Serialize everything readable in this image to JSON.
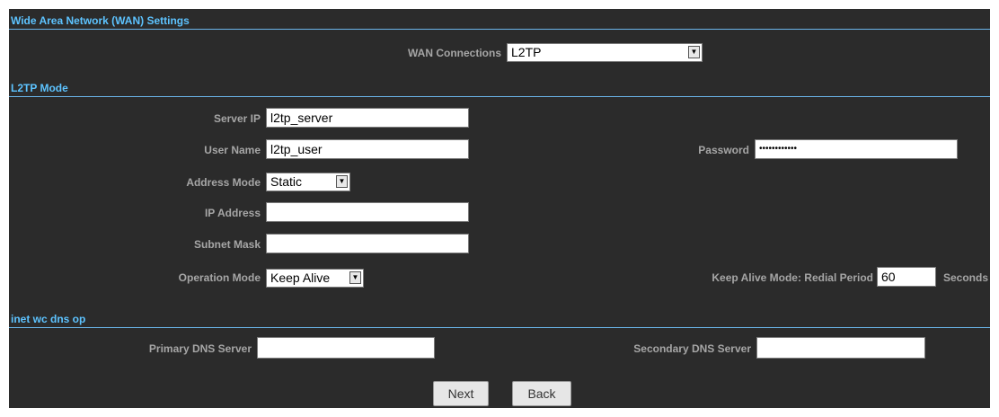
{
  "wan_section": {
    "title": "Wide Area Network (WAN) Settings",
    "connections_label": "WAN Connections",
    "connections_value": "L2TP"
  },
  "l2tp_section": {
    "title": "L2TP Mode",
    "server_ip_label": "Server IP",
    "server_ip_value": "l2tp_server",
    "user_name_label": "User Name",
    "user_name_value": "l2tp_user",
    "password_label": "Password",
    "password_value": "••••••••••••",
    "address_mode_label": "Address Mode",
    "address_mode_value": "Static",
    "ip_address_label": "IP Address",
    "ip_address_value": "",
    "subnet_mask_label": "Subnet Mask",
    "subnet_mask_value": "",
    "operation_mode_label": "Operation Mode",
    "operation_mode_value": "Keep Alive",
    "redial_label": "Keep Alive Mode: Redial Period",
    "redial_value": "60",
    "redial_unit": "Seconds"
  },
  "dns_section": {
    "title": "inet wc dns op",
    "primary_label": "Primary DNS Server",
    "primary_value": "",
    "secondary_label": "Secondary DNS Server",
    "secondary_value": ""
  },
  "buttons": {
    "next": "Next",
    "back": "Back"
  },
  "icons": {
    "dropdown": "dropdown-arrow-icon"
  }
}
